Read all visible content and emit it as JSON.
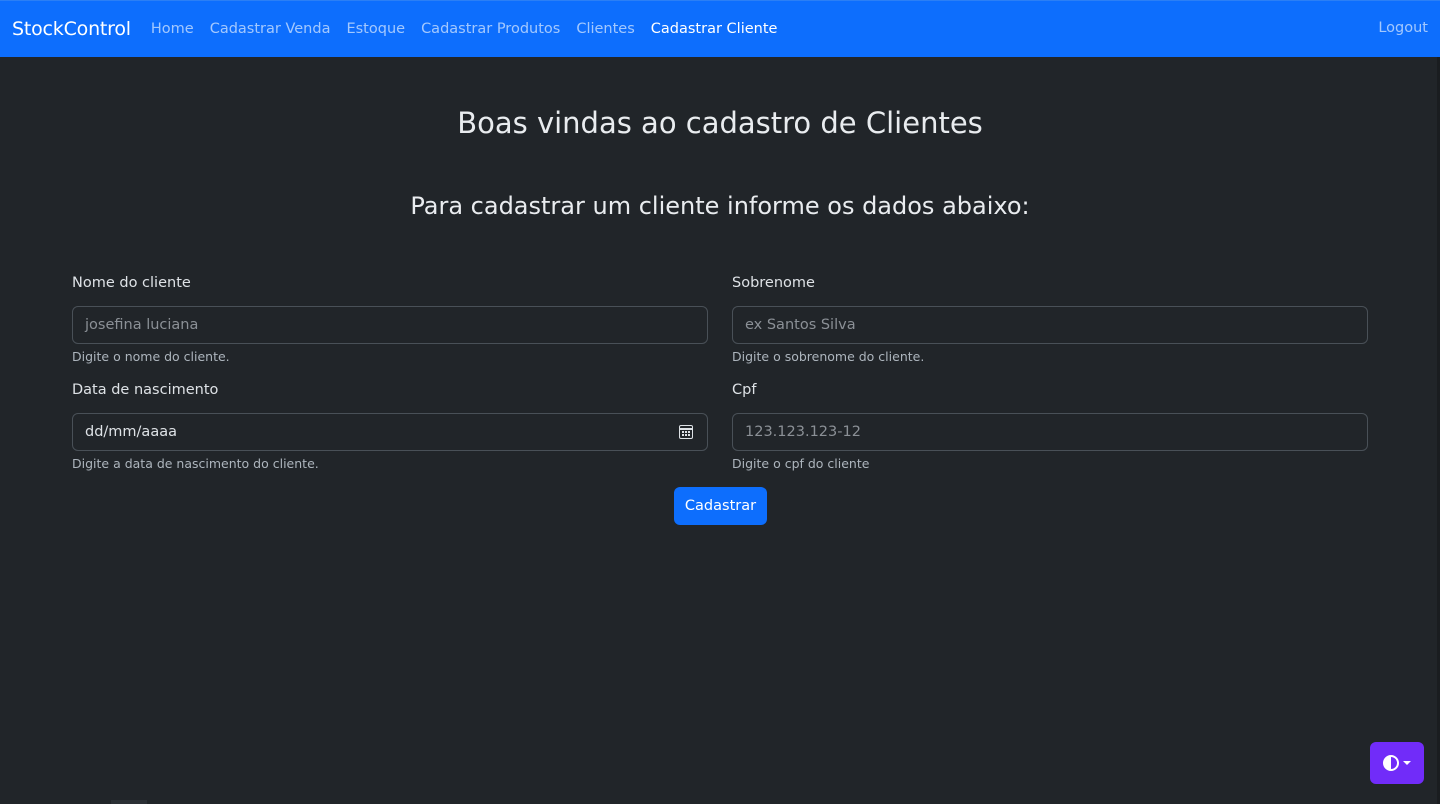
{
  "navbar": {
    "brand": "StockControl",
    "links": [
      {
        "label": "Home",
        "active": false
      },
      {
        "label": "Cadastrar Venda",
        "active": false
      },
      {
        "label": "Estoque",
        "active": false
      },
      {
        "label": "Cadastrar Produtos",
        "active": false
      },
      {
        "label": "Clientes",
        "active": false
      },
      {
        "label": "Cadastrar Cliente",
        "active": true
      }
    ],
    "logout": "Logout"
  },
  "main": {
    "title": "Boas vindas ao cadastro de Clientes",
    "subtitle": "Para cadastrar um cliente informe os dados abaixo:"
  },
  "form": {
    "nome": {
      "label": "Nome do cliente",
      "placeholder": "josefina luciana",
      "value": "",
      "help": "Digite o nome do cliente."
    },
    "sobrenome": {
      "label": "Sobrenome",
      "placeholder": "ex Santos Silva",
      "value": "",
      "help": "Digite o sobrenome do cliente."
    },
    "nascimento": {
      "label": "Data de nascimento",
      "value": "dd/mm/aaaa",
      "help": "Digite a data de nascimento do cliente."
    },
    "cpf": {
      "label": "Cpf",
      "placeholder": "123.123.123-12",
      "value": "",
      "help": "Digite o cpf do cliente"
    },
    "submit_label": "Cadastrar"
  },
  "colors": {
    "navbar_bg": "#0d6efd",
    "page_bg": "#212529",
    "primary": "#0d6efd",
    "theme_toggle": "#712cf9"
  },
  "icons": {
    "date_picker": "calendar-icon",
    "theme_toggle": "contrast-icon"
  }
}
